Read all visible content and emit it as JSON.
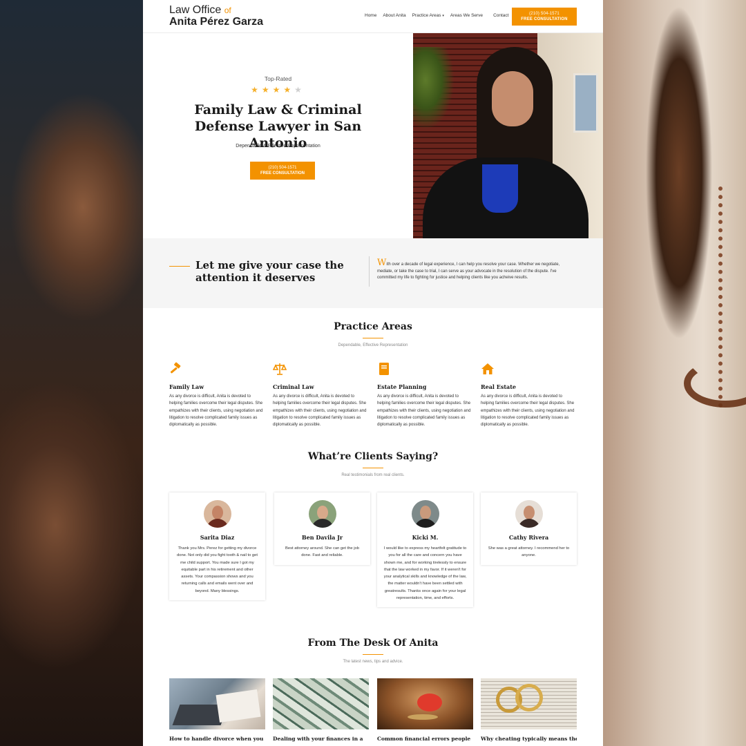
{
  "colors": {
    "accent": "#f39200",
    "star": "#f5b02c",
    "text": "#222222"
  },
  "header": {
    "logo_line1": "Law Office",
    "logo_of": "of",
    "logo_line2": "Anita Pérez Garza",
    "nav": [
      "Home",
      "About Anita",
      "Practice Areas",
      "Areas We Serve",
      "Contact"
    ],
    "cta_phone": "(210) 504-1571",
    "cta_label": "FREE CONSULTATION"
  },
  "hero": {
    "eyebrow": "Top-Rated",
    "rating": 4,
    "rating_max": 5,
    "title": "Family Law & Criminal Defense Lawyer in San Antonio",
    "subtitle": "Dependable & Effective Representation",
    "cta_phone": "(210) 504-1571",
    "cta_label": "FREE CONSULTATION"
  },
  "intro": {
    "title": "Let me give your case the attention it deserves",
    "drop_cap": "W",
    "text": "ith over a decade of legal experience, I can help you resolve your case. Whether we negotiate, mediate, or take the case to trial, I can serve as your advocate in the resolution of the dispute. I've committed my life to fighting for justice and helping clients like you acheive results."
  },
  "practice": {
    "title": "Practice Areas",
    "subtitle": "Dependable, Effective Representation",
    "items": [
      {
        "icon": "gavel-icon",
        "title": "Family Law",
        "text": "As any divorce is difficult, Anita is devoted to helping families overcome their legal disputes. She empathizes with their clients, using negotiation and litigation to resolve complicated family issues as diplomatically as possible."
      },
      {
        "icon": "scales-icon",
        "title": "Criminal Law",
        "text": "As any divorce is difficult, Anita is devoted to helping families overcome their legal disputes. She empathizes with their clients, using negotiation and litigation to resolve complicated family issues as diplomatically as possible."
      },
      {
        "icon": "book-icon",
        "title": "Estate Planning",
        "text": "As any divorce is difficult, Anita is devoted to helping families overcome their legal disputes. She empathizes with their clients, using negotiation and litigation to resolve complicated family issues as diplomatically as possible."
      },
      {
        "icon": "home-icon",
        "title": "Real Estate",
        "text": "As any divorce is difficult, Anita is devoted to helping families overcome their legal disputes. She empathizes with their clients, using negotiation and litigation to resolve complicated family issues as diplomatically as possible."
      }
    ]
  },
  "testimonials": {
    "title": "What’re Clients Saying?",
    "subtitle": "Real testimonials from real clients.",
    "items": [
      {
        "name": "Sarita Diaz",
        "quote": "Thank you Mrs. Perez for getting my divorce done. Not only did you fight tooth & nail to get me child support. You made sure I got my equitable part in his retirement and other assets.  Your compassion shows and you returning calls and emails went over and beyond. Many blessings."
      },
      {
        "name": "Ben Davila Jr",
        "quote": "Best attorney around. She can get the job done. Fast and reliable."
      },
      {
        "name": "Kicki M.",
        "quote": "I would like to express my heartfelt gratitude to you for all the care and concern you have shown me, and for working tirelessly to ensure that the law worked in my favor. If it weren't for your analytical skills and knowledge of the law, the matter wouldn't have been settled with greatresults. Thanks once again for your legal representation, time, and efforts."
      },
      {
        "name": "Cathy Rivera",
        "quote": "She was a great attorney.  I recommend her to anyone."
      }
    ]
  },
  "blog": {
    "title": "From The Desk Of Anita",
    "subtitle": "The latest news, tips and advice.",
    "posts": [
      {
        "title": "How to handle divorce when you"
      },
      {
        "title": "Dealing with your finances in a"
      },
      {
        "title": "Common financial errors people"
      },
      {
        "title": "Why cheating typically means the"
      }
    ]
  }
}
